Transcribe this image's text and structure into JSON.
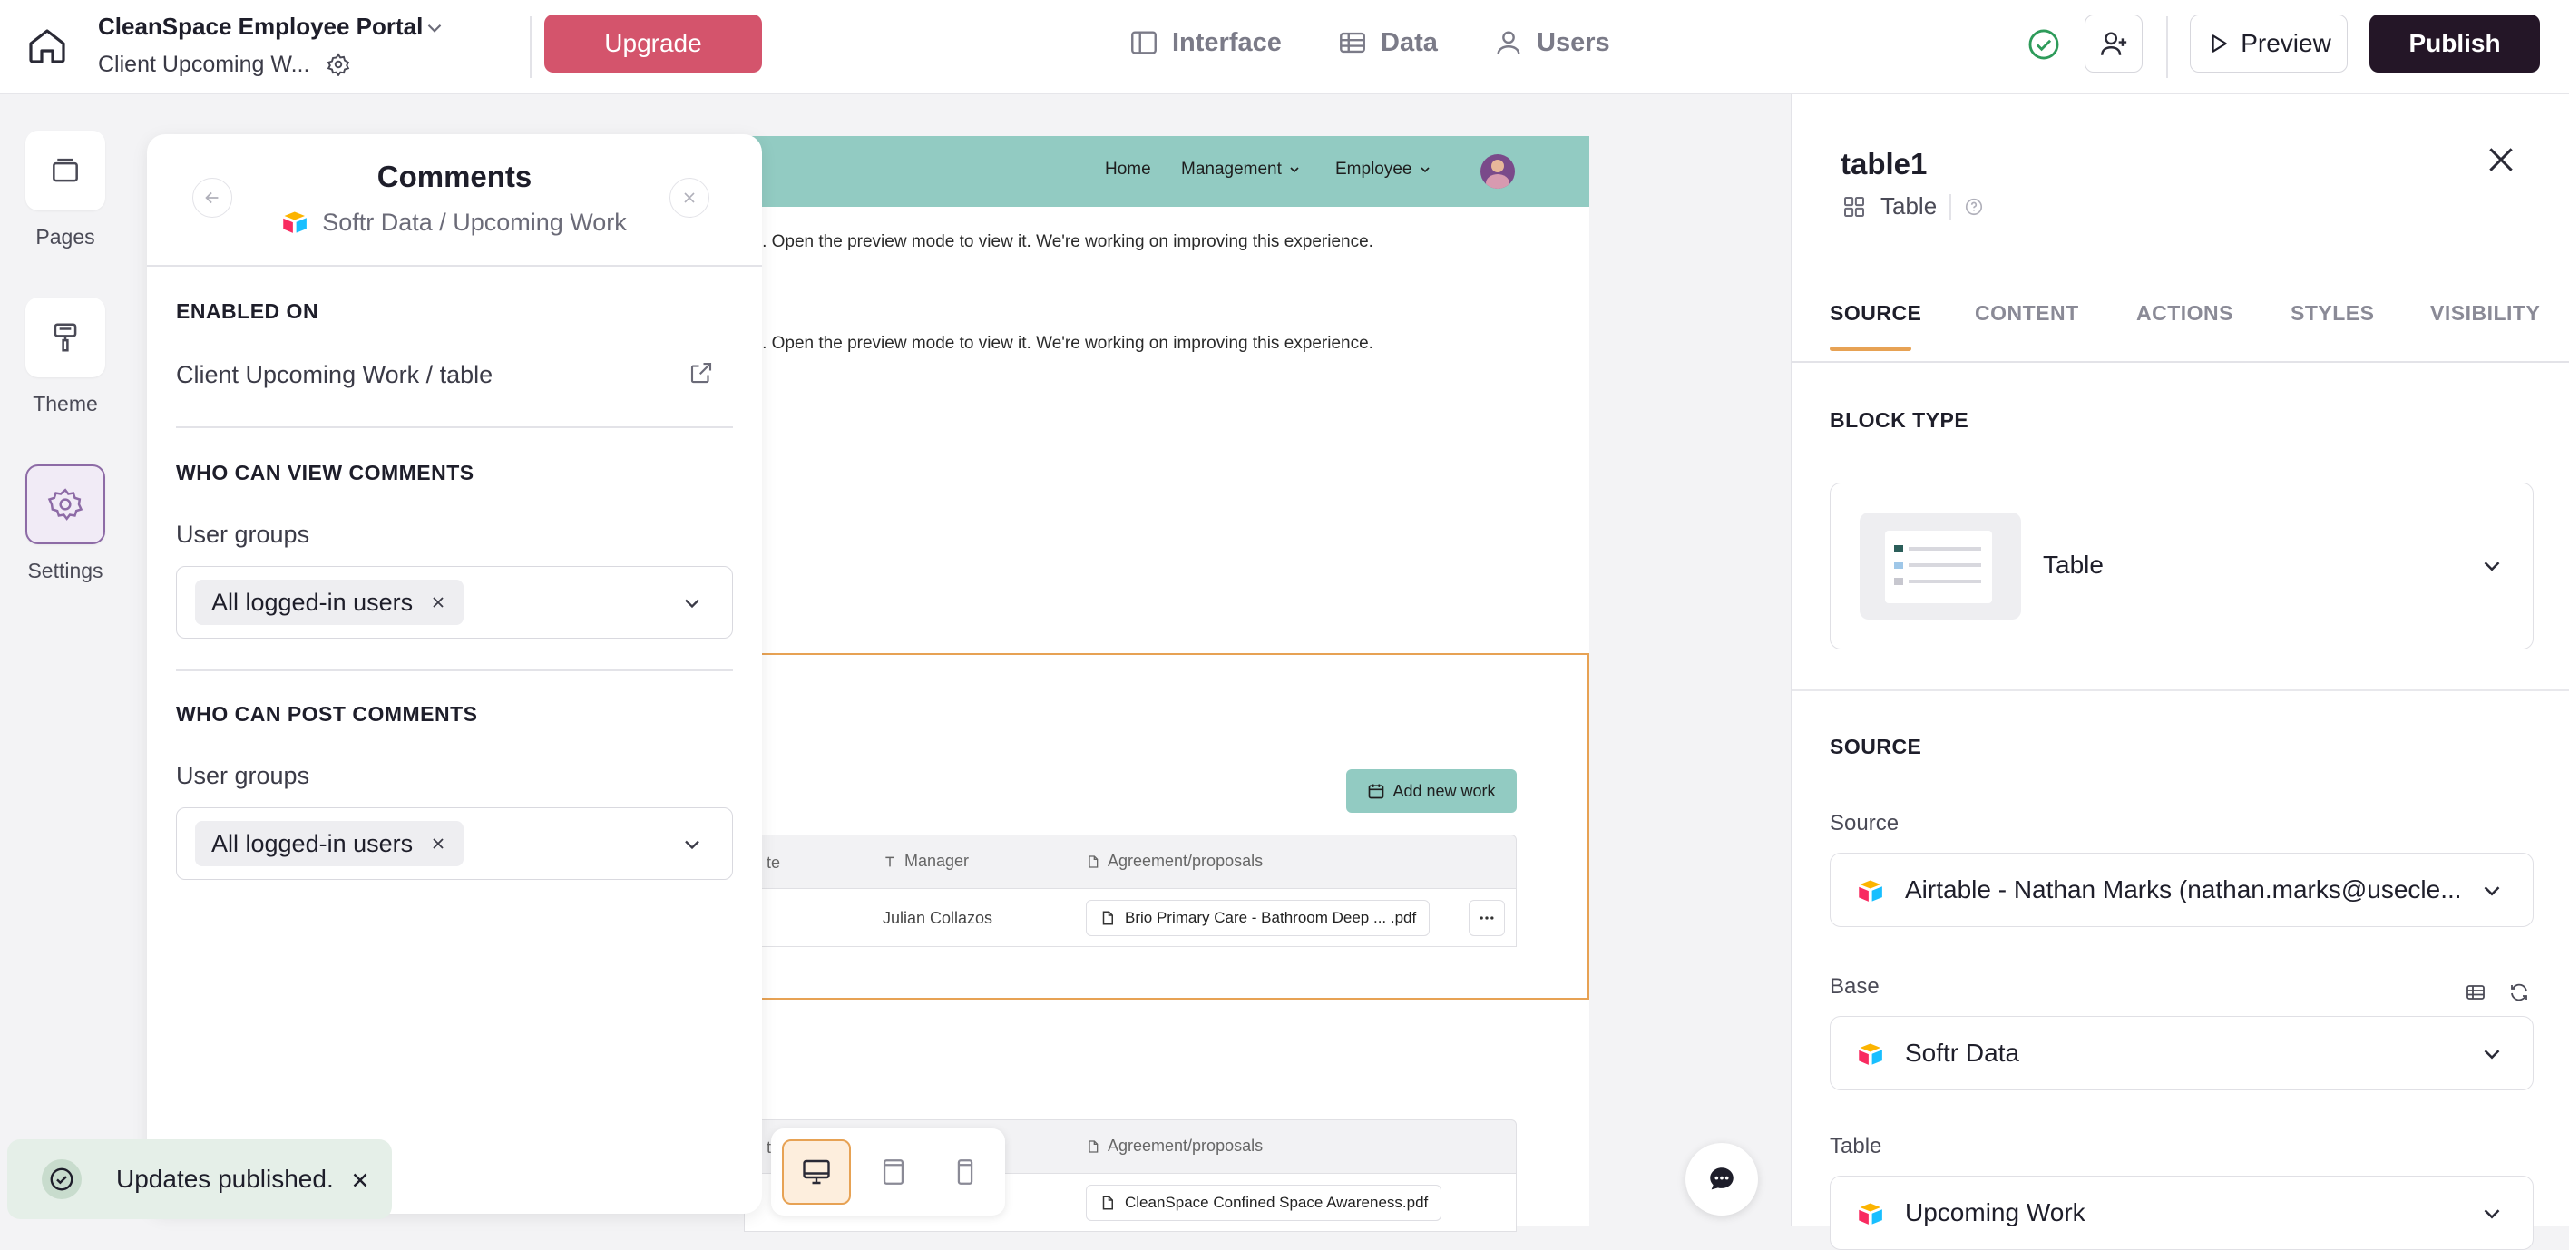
{
  "topbar": {
    "app_name": "CleanSpace Employee Portal",
    "page_name": "Client Upcoming W...",
    "upgrade_label": "Upgrade",
    "nav": [
      {
        "label": "Interface",
        "icon": "layout-icon"
      },
      {
        "label": "Data",
        "icon": "table-icon"
      },
      {
        "label": "Users",
        "icon": "user-icon"
      }
    ],
    "preview_label": "Preview",
    "publish_label": "Publish"
  },
  "rail": {
    "items": [
      {
        "label": "Pages",
        "icon": "pages-icon"
      },
      {
        "label": "Theme",
        "icon": "paint-roller-icon"
      },
      {
        "label": "Settings",
        "icon": "gear-icon",
        "active": true
      }
    ]
  },
  "canvas": {
    "nav": [
      "Home",
      "Management",
      "Employee"
    ],
    "notice_1": "as. Open the preview mode to view it. We're working on improving this experience.",
    "notice_2": "as. Open the preview mode to view it. We're working on improving this experience.",
    "add_button": "Add new work",
    "table1": {
      "col_date": "te",
      "col_manager": "Manager",
      "col_agreement": "Agreement/proposals",
      "row_manager": "Julian Collazos",
      "row_file": "Brio Primary Care - Bathroom Deep ... .pdf"
    },
    "table2": {
      "col_date": "te",
      "col_agreement": "Agreement/proposals",
      "row_file": "CleanSpace Confined Space Awareness.pdf"
    }
  },
  "comments": {
    "title": "Comments",
    "subtitle": "Softr Data / Upcoming Work",
    "enabled_on_title": "ENABLED ON",
    "enabled_on_value": "Client Upcoming Work / table",
    "view_title": "WHO CAN VIEW COMMENTS",
    "view_label": "User groups",
    "view_pill": "All logged-in users",
    "post_title": "WHO CAN POST COMMENTS",
    "post_label": "User groups",
    "post_pill": "All logged-in users"
  },
  "rpanel": {
    "block_name": "table1",
    "block_kind": "Table",
    "tabs": [
      "SOURCE",
      "CONTENT",
      "ACTIONS",
      "STYLES",
      "VISIBILITY"
    ],
    "active_tab": "SOURCE",
    "block_type_title": "BLOCK TYPE",
    "block_type_value": "Table",
    "source_title": "SOURCE",
    "source_label": "Source",
    "source_value": "Airtable - Nathan Marks (nathan.marks@usecle...",
    "base_label": "Base",
    "base_value": "Softr Data",
    "table_label": "Table",
    "table_value": "Upcoming Work"
  },
  "toast": {
    "message": "Updates published."
  },
  "colors": {
    "accent_upgrade": "#d4546c",
    "publish_bg": "#241627",
    "canvas_header": "#92cbc2",
    "selection_outline": "#e7a254",
    "active_tab_underline": "#e7a254",
    "success": "#2e9b5a"
  }
}
